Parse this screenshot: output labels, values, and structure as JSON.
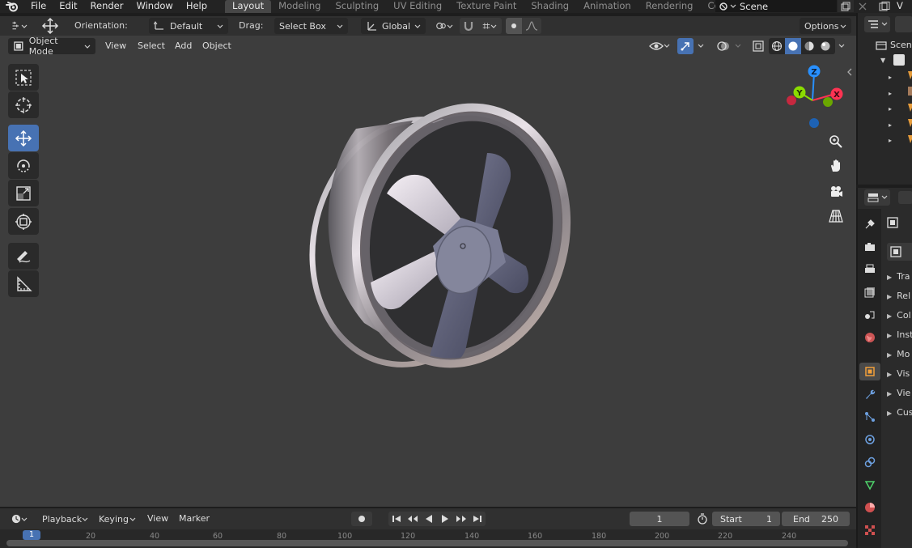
{
  "menu": {
    "items": [
      "File",
      "Edit",
      "Render",
      "Window",
      "Help"
    ]
  },
  "workspaces": {
    "tabs": [
      "Layout",
      "Modeling",
      "Sculpting",
      "UV Editing",
      "Texture Paint",
      "Shading",
      "Animation",
      "Rendering",
      "Compositing"
    ],
    "active": "Layout"
  },
  "scene": {
    "name": "Scene",
    "view_layer_fragment": "V"
  },
  "tool_header": {
    "orientation_label": "Orientation:",
    "orientation_value": "Default",
    "drag_label": "Drag:",
    "drag_value": "Select Box",
    "transform_space": "Global",
    "options_label": "Options"
  },
  "viewport_header": {
    "mode": "Object Mode",
    "menus": [
      "View",
      "Select",
      "Add",
      "Object"
    ]
  },
  "gizmo": {
    "x": "X",
    "y": "Y",
    "z": "Z"
  },
  "outliner": {
    "root_fragment": "Scen"
  },
  "properties": {
    "rows": [
      "Tra",
      "Rel",
      "Col",
      "Inst",
      "Mo",
      "Vis",
      "Vie",
      "Cus"
    ]
  },
  "timeline": {
    "menus": [
      "Playback",
      "Keying",
      "View",
      "Marker"
    ],
    "current_frame": "1",
    "start_label": "Start",
    "start_value": "1",
    "end_label": "End",
    "end_value": "250",
    "ruler_ticks": [
      "1",
      "20",
      "40",
      "60",
      "80",
      "100",
      "120",
      "140",
      "160",
      "180",
      "200",
      "220",
      "240"
    ]
  },
  "colors": {
    "active_blue": "#4772b3",
    "axis_x": "#ff3352",
    "axis_y": "#8bdc00",
    "axis_z": "#2890ff"
  }
}
